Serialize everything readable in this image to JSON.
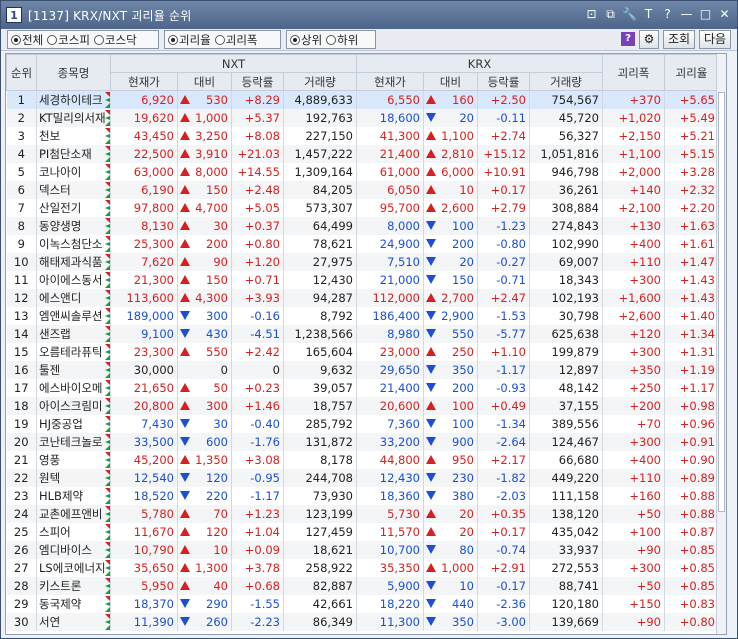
{
  "window": {
    "num": "1",
    "title": "[1137] KRX/NXT 괴리율 순위",
    "tools": [
      "⊡",
      "⧉",
      "🔧",
      "T",
      "?",
      "—",
      "□",
      "✕"
    ]
  },
  "filters": {
    "market": [
      "전체",
      "코스피",
      "코스닥"
    ],
    "market_sel": 0,
    "metric": [
      "괴리율",
      "괴리폭"
    ],
    "metric_sel": 0,
    "order": [
      "상위",
      "하위"
    ],
    "order_sel": 0,
    "help": "?",
    "tool_icon": "⚙",
    "query": "조회",
    "next": "다음"
  },
  "headers": {
    "rank": "순위",
    "name": "종목명",
    "nxt": "NXT",
    "krx": "KRX",
    "price": "현재가",
    "diff": "대비",
    "rate": "등락률",
    "vol": "거래량",
    "gap": "괴리폭",
    "gaprate": "괴리율"
  },
  "rows": [
    {
      "r": "1",
      "name": "세경하이테크",
      "np": "6,920",
      "nd": "530",
      "ndir": "up",
      "nr": "+8.29",
      "nv": "4,889,633",
      "kp": "6,550",
      "kd": "160",
      "kdir": "up",
      "kr": "+2.50",
      "kv": "754,567",
      "gap": "+370",
      "gr": "+5.65"
    },
    {
      "r": "2",
      "name": "KT밀리의서재",
      "np": "19,620",
      "nd": "1,000",
      "ndir": "up",
      "nr": "+5.37",
      "nv": "192,763",
      "kp": "18,600",
      "kd": "20",
      "kdir": "dn",
      "kr": "-0.11",
      "kv": "45,720",
      "gap": "+1,020",
      "gr": "+5.49"
    },
    {
      "r": "3",
      "name": "천보",
      "np": "43,450",
      "nd": "3,250",
      "ndir": "up",
      "nr": "+8.08",
      "nv": "227,150",
      "kp": "41,300",
      "kd": "1,100",
      "kdir": "up",
      "kr": "+2.74",
      "kv": "56,327",
      "gap": "+2,150",
      "gr": "+5.21"
    },
    {
      "r": "4",
      "name": "PI첨단소재",
      "np": "22,500",
      "nd": "3,910",
      "ndir": "up",
      "nr": "+21.03",
      "nv": "1,457,222",
      "kp": "21,400",
      "kd": "2,810",
      "kdir": "up",
      "kr": "+15.12",
      "kv": "1,051,816",
      "gap": "+1,100",
      "gr": "+5.15"
    },
    {
      "r": "5",
      "name": "코나아이",
      "np": "63,000",
      "nd": "8,000",
      "ndir": "up",
      "nr": "+14.55",
      "nv": "1,309,164",
      "kp": "61,000",
      "kd": "6,000",
      "kdir": "up",
      "kr": "+10.91",
      "kv": "946,798",
      "gap": "+2,000",
      "gr": "+3.28"
    },
    {
      "r": "6",
      "name": "덱스터",
      "np": "6,190",
      "nd": "150",
      "ndir": "up",
      "nr": "+2.48",
      "nv": "84,205",
      "kp": "6,050",
      "kd": "10",
      "kdir": "up",
      "kr": "+0.17",
      "kv": "36,261",
      "gap": "+140",
      "gr": "+2.32"
    },
    {
      "r": "7",
      "name": "산일전기",
      "np": "97,800",
      "nd": "4,700",
      "ndir": "up",
      "nr": "+5.05",
      "nv": "573,307",
      "kp": "95,700",
      "kd": "2,600",
      "kdir": "up",
      "kr": "+2.79",
      "kv": "308,884",
      "gap": "+2,100",
      "gr": "+2.20"
    },
    {
      "r": "8",
      "name": "동양생명",
      "np": "8,130",
      "nd": "30",
      "ndir": "up",
      "nr": "+0.37",
      "nv": "64,499",
      "kp": "8,000",
      "kd": "100",
      "kdir": "dn",
      "kr": "-1.23",
      "kv": "274,843",
      "gap": "+130",
      "gr": "+1.63"
    },
    {
      "r": "9",
      "name": "이녹스첨단소",
      "np": "25,300",
      "nd": "200",
      "ndir": "up",
      "nr": "+0.80",
      "nv": "78,621",
      "kp": "24,900",
      "kd": "200",
      "kdir": "dn",
      "kr": "-0.80",
      "kv": "102,990",
      "gap": "+400",
      "gr": "+1.61"
    },
    {
      "r": "10",
      "name": "해태제과식품",
      "np": "7,620",
      "nd": "90",
      "ndir": "up",
      "nr": "+1.20",
      "nv": "27,975",
      "kp": "7,510",
      "kd": "20",
      "kdir": "dn",
      "kr": "-0.27",
      "kv": "69,007",
      "gap": "+110",
      "gr": "+1.47"
    },
    {
      "r": "11",
      "name": "아이에스동서",
      "np": "21,300",
      "nd": "150",
      "ndir": "up",
      "nr": "+0.71",
      "nv": "12,430",
      "kp": "21,000",
      "kd": "150",
      "kdir": "dn",
      "kr": "-0.71",
      "kv": "18,343",
      "gap": "+300",
      "gr": "+1.43"
    },
    {
      "r": "12",
      "name": "에스앤디",
      "np": "113,600",
      "nd": "4,300",
      "ndir": "up",
      "nr": "+3.93",
      "nv": "94,287",
      "kp": "112,000",
      "kd": "2,700",
      "kdir": "up",
      "kr": "+2.47",
      "kv": "102,193",
      "gap": "+1,600",
      "gr": "+1.43"
    },
    {
      "r": "13",
      "name": "엠앤씨솔루션",
      "np": "189,000",
      "nd": "300",
      "ndir": "dn",
      "nr": "-0.16",
      "nv": "8,792",
      "kp": "186,400",
      "kd": "2,900",
      "kdir": "dn",
      "kr": "-1.53",
      "kv": "30,798",
      "gap": "+2,600",
      "gr": "+1.40"
    },
    {
      "r": "14",
      "name": "샌즈랩",
      "np": "9,100",
      "nd": "430",
      "ndir": "dn",
      "nr": "-4.51",
      "nv": "1,238,566",
      "kp": "8,980",
      "kd": "550",
      "kdir": "dn",
      "kr": "-5.77",
      "kv": "625,638",
      "gap": "+120",
      "gr": "+1.34"
    },
    {
      "r": "15",
      "name": "오름테라퓨틱",
      "np": "23,300",
      "nd": "550",
      "ndir": "up",
      "nr": "+2.42",
      "nv": "165,604",
      "kp": "23,000",
      "kd": "250",
      "kdir": "up",
      "kr": "+1.10",
      "kv": "199,879",
      "gap": "+300",
      "gr": "+1.31"
    },
    {
      "r": "16",
      "name": "툴젠",
      "np": "30,000",
      "nd": "0",
      "ndir": "",
      "nr": "0",
      "nv": "9,632",
      "kp": "29,650",
      "kd": "350",
      "kdir": "dn",
      "kr": "-1.17",
      "kv": "12,897",
      "gap": "+350",
      "gr": "+1.19"
    },
    {
      "r": "17",
      "name": "에스바이오메",
      "np": "21,650",
      "nd": "50",
      "ndir": "up",
      "nr": "+0.23",
      "nv": "39,057",
      "kp": "21,400",
      "kd": "200",
      "kdir": "dn",
      "kr": "-0.93",
      "kv": "48,142",
      "gap": "+250",
      "gr": "+1.17"
    },
    {
      "r": "18",
      "name": "아이스크림미",
      "np": "20,800",
      "nd": "300",
      "ndir": "up",
      "nr": "+1.46",
      "nv": "18,757",
      "kp": "20,600",
      "kd": "100",
      "kdir": "up",
      "kr": "+0.49",
      "kv": "37,155",
      "gap": "+200",
      "gr": "+0.98"
    },
    {
      "r": "19",
      "name": "HJ중공업",
      "np": "7,430",
      "nd": "30",
      "ndir": "dn",
      "nr": "-0.40",
      "nv": "285,792",
      "kp": "7,360",
      "kd": "100",
      "kdir": "dn",
      "kr": "-1.34",
      "kv": "389,556",
      "gap": "+70",
      "gr": "+0.96"
    },
    {
      "r": "20",
      "name": "코난테크놀로",
      "np": "33,500",
      "nd": "600",
      "ndir": "dn",
      "nr": "-1.76",
      "nv": "131,872",
      "kp": "33,200",
      "kd": "900",
      "kdir": "dn",
      "kr": "-2.64",
      "kv": "124,467",
      "gap": "+300",
      "gr": "+0.91"
    },
    {
      "r": "21",
      "name": "영풍",
      "np": "45,200",
      "nd": "1,350",
      "ndir": "up",
      "nr": "+3.08",
      "nv": "8,178",
      "kp": "44,800",
      "kd": "950",
      "kdir": "up",
      "kr": "+2.17",
      "kv": "66,680",
      "gap": "+400",
      "gr": "+0.90"
    },
    {
      "r": "22",
      "name": "원텍",
      "np": "12,540",
      "nd": "120",
      "ndir": "dn",
      "nr": "-0.95",
      "nv": "244,708",
      "kp": "12,430",
      "kd": "230",
      "kdir": "dn",
      "kr": "-1.82",
      "kv": "449,220",
      "gap": "+110",
      "gr": "+0.89"
    },
    {
      "r": "23",
      "name": "HLB제약",
      "np": "18,520",
      "nd": "220",
      "ndir": "dn",
      "nr": "-1.17",
      "nv": "73,930",
      "kp": "18,360",
      "kd": "380",
      "kdir": "dn",
      "kr": "-2.03",
      "kv": "111,158",
      "gap": "+160",
      "gr": "+0.88"
    },
    {
      "r": "24",
      "name": "교촌에프앤비",
      "np": "5,780",
      "nd": "70",
      "ndir": "up",
      "nr": "+1.23",
      "nv": "123,199",
      "kp": "5,730",
      "kd": "20",
      "kdir": "up",
      "kr": "+0.35",
      "kv": "138,120",
      "gap": "+50",
      "gr": "+0.88"
    },
    {
      "r": "25",
      "name": "스피어",
      "np": "11,670",
      "nd": "120",
      "ndir": "up",
      "nr": "+1.04",
      "nv": "127,459",
      "kp": "11,570",
      "kd": "20",
      "kdir": "up",
      "kr": "+0.17",
      "kv": "435,042",
      "gap": "+100",
      "gr": "+0.87"
    },
    {
      "r": "26",
      "name": "엠디바이스",
      "np": "10,790",
      "nd": "10",
      "ndir": "up",
      "nr": "+0.09",
      "nv": "18,621",
      "kp": "10,700",
      "kd": "80",
      "kdir": "dn",
      "kr": "-0.74",
      "kv": "33,937",
      "gap": "+90",
      "gr": "+0.85"
    },
    {
      "r": "27",
      "name": "LS에코에너지",
      "np": "35,650",
      "nd": "1,300",
      "ndir": "up",
      "nr": "+3.78",
      "nv": "258,922",
      "kp": "35,350",
      "kd": "1,000",
      "kdir": "up",
      "kr": "+2.91",
      "kv": "272,553",
      "gap": "+300",
      "gr": "+0.85"
    },
    {
      "r": "28",
      "name": "키스트론",
      "np": "5,950",
      "nd": "40",
      "ndir": "up",
      "nr": "+0.68",
      "nv": "82,887",
      "kp": "5,900",
      "kd": "10",
      "kdir": "dn",
      "kr": "-0.17",
      "kv": "88,741",
      "gap": "+50",
      "gr": "+0.85"
    },
    {
      "r": "29",
      "name": "동국제약",
      "np": "18,370",
      "nd": "290",
      "ndir": "dn",
      "nr": "-1.55",
      "nv": "42,661",
      "kp": "18,220",
      "kd": "440",
      "kdir": "dn",
      "kr": "-2.36",
      "kv": "120,180",
      "gap": "+150",
      "gr": "+0.83"
    },
    {
      "r": "30",
      "name": "서연",
      "np": "11,390",
      "nd": "260",
      "ndir": "dn",
      "nr": "-2.23",
      "nv": "86,349",
      "kp": "11,300",
      "kd": "350",
      "kdir": "dn",
      "kr": "-3.00",
      "kv": "139,669",
      "gap": "+90",
      "gr": "+0.80"
    }
  ]
}
